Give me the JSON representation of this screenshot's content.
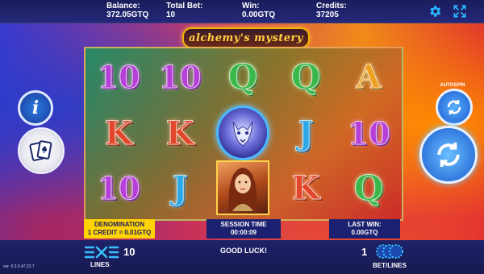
{
  "top_bar": {
    "balance_label": "Balance:",
    "balance_value": "372.05GTQ",
    "total_bet_label": "Total Bet:",
    "total_bet_value": "10",
    "win_label": "Win:",
    "win_value": "0.00GTQ",
    "credits_label": "Credits:",
    "credits_value": "37205",
    "icons": [
      "gear-icon",
      "fullscreen-icon"
    ]
  },
  "logo": {
    "text": "alchemy's mystery"
  },
  "reels": {
    "rows": [
      [
        "10",
        "10",
        "Q",
        "Q",
        "A"
      ],
      [
        "K",
        "K",
        "wolf",
        "J",
        "10"
      ],
      [
        "10",
        "J",
        "alchemist",
        "K",
        "Q"
      ]
    ],
    "symbol_colors": {
      "10": "#b53fd8",
      "K": "#e2452a",
      "Q": "#3ab84a",
      "J": "#2aa8e8",
      "A": "#f0a020"
    }
  },
  "side_buttons": {
    "info_icon": "info-icon",
    "paytable_icon": "playing-cards-icon",
    "autospin_label": "AUTOSPIN",
    "autospin_icon": "refresh-icon",
    "spin_icon": "refresh-icon"
  },
  "info_panel": {
    "denomination_label": "DENOMINATION",
    "denomination_value": "1 CREDIT = 0.01GTQ",
    "session_time_label": "SESSION TIME",
    "session_time_value": "00:00:09",
    "last_win_label": "LAST WIN:",
    "last_win_value": "0.00GTQ"
  },
  "bottom_bar": {
    "lines_label": "LINES",
    "lines_value": "10",
    "message": "GOOD LUCK!",
    "bet_lines_label": "BET/LINES",
    "bet_lines_value": "1",
    "version": "ver. 0.3.0.47.22.7"
  },
  "colors": {
    "top_bar_bg": "#1a1d5a",
    "accent_blue": "#29b6ff",
    "denomination_bg": "#ffd400",
    "logo_gold": "#ffd24a"
  }
}
